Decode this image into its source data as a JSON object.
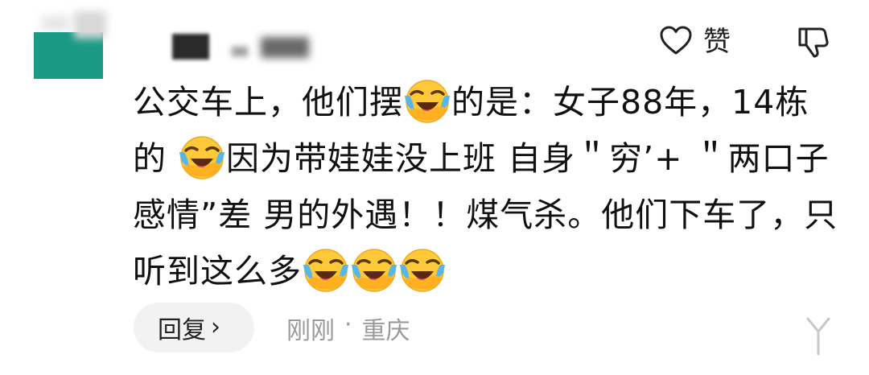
{
  "comment": {
    "like_label": "赞",
    "segments": [
      {
        "type": "text",
        "value": "公交车上，他们摆"
      },
      {
        "type": "emoji",
        "name": "laughing-crying-emoji"
      },
      {
        "type": "text",
        "value": "的是：女子88年，14栋的 "
      },
      {
        "type": "emoji",
        "name": "laughing-crying-emoji"
      },
      {
        "type": "text",
        "value": "因为带娃娃没上班 自身＂穷’+ ＂两口子感情”差 男的外遇！！煤气杀。他们下车了，只听到这么多"
      },
      {
        "type": "emoji",
        "name": "laughing-crying-emoji"
      },
      {
        "type": "emoji",
        "name": "laughing-crying-emoji"
      },
      {
        "type": "emoji",
        "name": "laughing-crying-emoji"
      }
    ]
  },
  "footer": {
    "reply_label": "回复",
    "reply_chevron": "›",
    "time": "刚刚",
    "separator": "·",
    "location": "重庆"
  },
  "icons": {
    "like": "heart-outline-icon",
    "dislike": "thumbs-down-icon",
    "emoji": "laughing-crying-emoji"
  },
  "colors": {
    "avatar": "#1a9a86",
    "text": "#111111",
    "meta": "#9a9a9a",
    "reply_bg": "#f2f2f2",
    "emoji_face": "#ffc93a",
    "emoji_tear": "#55b8e8"
  }
}
